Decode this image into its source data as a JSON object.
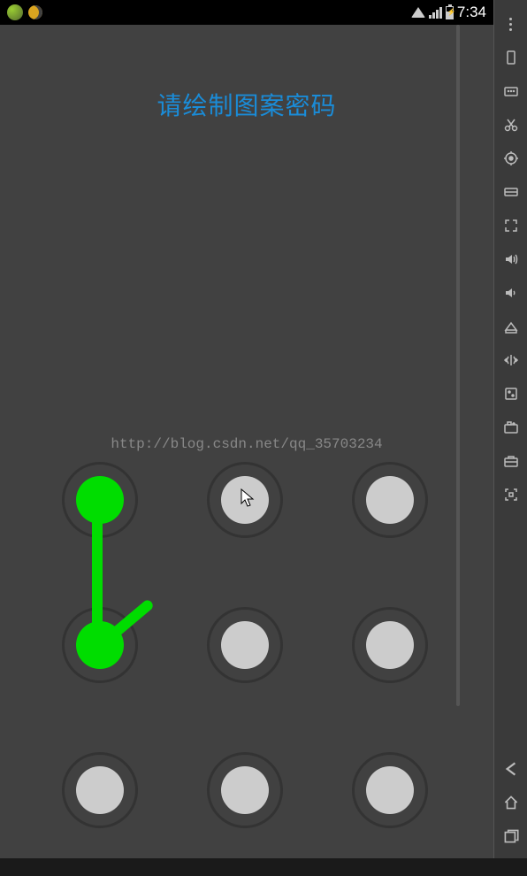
{
  "status_bar": {
    "time": "7:34"
  },
  "screen": {
    "title": "请绘制图案密码",
    "watermark": "http://blog.csdn.net/qq_35703234"
  },
  "pattern": {
    "selected_nodes": [
      0,
      3
    ],
    "lines": [
      {
        "from": 0,
        "to": 3
      },
      {
        "from": 3,
        "angle_deg": -40,
        "length": 80
      }
    ]
  },
  "sidebar": {
    "items": [
      {
        "name": "more",
        "icon": "dots"
      },
      {
        "name": "rotate",
        "icon": "rotate"
      },
      {
        "name": "keyboard",
        "icon": "keyboard"
      },
      {
        "name": "cut",
        "icon": "scissors"
      },
      {
        "name": "location",
        "icon": "target"
      },
      {
        "name": "list",
        "icon": "list"
      },
      {
        "name": "fullscreen",
        "icon": "expand"
      },
      {
        "name": "volume-up",
        "icon": "vol-up"
      },
      {
        "name": "volume-down",
        "icon": "vol-down"
      },
      {
        "name": "apk",
        "icon": "apk"
      },
      {
        "name": "shake",
        "icon": "shake"
      },
      {
        "name": "touch",
        "icon": "touch"
      },
      {
        "name": "camera",
        "icon": "camera"
      },
      {
        "name": "briefcase",
        "icon": "briefcase"
      },
      {
        "name": "scan",
        "icon": "scan"
      }
    ],
    "nav": [
      {
        "name": "back",
        "icon": "back"
      },
      {
        "name": "home",
        "icon": "home"
      },
      {
        "name": "recent",
        "icon": "recent"
      }
    ]
  }
}
